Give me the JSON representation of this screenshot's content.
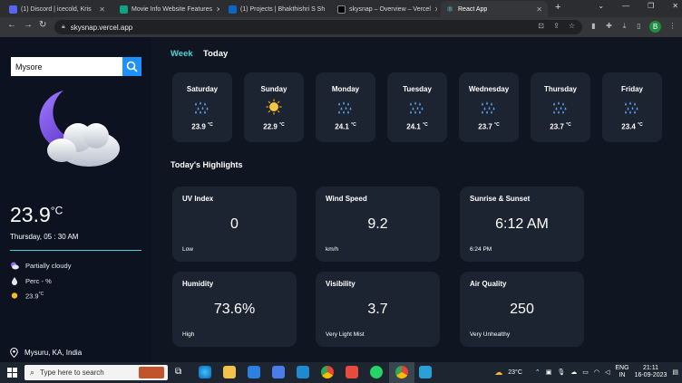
{
  "browser": {
    "tabs": [
      {
        "title": "(1) Discord | icecold, Kris",
        "color": "#5865f2"
      },
      {
        "title": "Movie Info Website Features",
        "color": "#10a37f"
      },
      {
        "title": "(1) Projects | Bhakthishri S Sh",
        "color": "#0a66c2"
      },
      {
        "title": "skysnap – Overview – Vercel",
        "color": "#000000"
      },
      {
        "title": "React App",
        "color": "#61dafb"
      }
    ],
    "url": "skysnap.vercel.app",
    "profile_initial": "B"
  },
  "sidebar": {
    "search_value": "Mysore",
    "temperature": "23.9",
    "temp_unit": "°C",
    "datetime": "Thursday, 05 : 30 AM",
    "conditions": [
      {
        "icon": "partly-cloudy-icon",
        "text": "Partially cloudy"
      },
      {
        "icon": "rain-drop-icon",
        "text": "Perc - %"
      },
      {
        "icon": "sun-icon",
        "text": "23.9",
        "unit": "°C"
      }
    ],
    "location": "Mysuru, KA, India"
  },
  "main": {
    "toggle_week": "Week",
    "toggle_today": "Today",
    "week": [
      {
        "day": "Saturday",
        "temp": "23.9",
        "unit": "°C",
        "icon": "rain-icon"
      },
      {
        "day": "Sunday",
        "temp": "22.9",
        "unit": "°C",
        "icon": "sun-icon"
      },
      {
        "day": "Monday",
        "temp": "24.1",
        "unit": "°C",
        "icon": "rain-icon"
      },
      {
        "day": "Tuesday",
        "temp": "24.1",
        "unit": "°C",
        "icon": "rain-icon"
      },
      {
        "day": "Wednesday",
        "temp": "23.7",
        "unit": "°C",
        "icon": "rain-icon"
      },
      {
        "day": "Thursday",
        "temp": "23.7",
        "unit": "°C",
        "icon": "rain-icon"
      },
      {
        "day": "Friday",
        "temp": "23.4",
        "unit": "°C",
        "icon": "rain-icon"
      }
    ],
    "highlights_title": "Today's Highlights",
    "highlights": [
      {
        "title": "UV Index",
        "value": "0",
        "sub": "Low"
      },
      {
        "title": "Wind Speed",
        "value": "9.2",
        "sub": "km/h"
      },
      {
        "title": "Sunrise & Sunset",
        "value": "6:12 AM",
        "sub": "6:24 PM"
      },
      {
        "title": "Humidity",
        "value": "73.6%",
        "sub": "High"
      },
      {
        "title": "Visibility",
        "value": "3.7",
        "sub": "Very Light Mist"
      },
      {
        "title": "Air Quality",
        "value": "250",
        "sub": "Very Unhealthy"
      }
    ]
  },
  "taskbar": {
    "search_placeholder": "Type here to search",
    "weather": "23°C",
    "lang1": "ENG",
    "lang2": "IN",
    "time": "21:11",
    "date": "16-09-2023"
  },
  "colors": {
    "accent": "#4fd1d9",
    "search_button": "#1e90ff",
    "card_bg": "#1c2331"
  }
}
